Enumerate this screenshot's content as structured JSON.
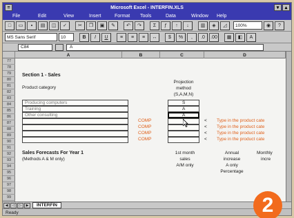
{
  "window": {
    "title": "Microsoft Excel - INTERFIN.XLS"
  },
  "menu": [
    "File",
    "Edit",
    "View",
    "Insert",
    "Format",
    "Tools",
    "Data",
    "Window",
    "Help"
  ],
  "toolbar": {
    "zoom": "100%"
  },
  "format_toolbar": {
    "font": "MS Sans Serif",
    "size": "10"
  },
  "formula_bar": {
    "name_box": "C84",
    "value": "A"
  },
  "columns": [
    "A",
    "B",
    "C",
    "D"
  ],
  "rows": [
    "77",
    "78",
    "79",
    "80",
    "81",
    "82",
    "83",
    "84",
    "85",
    "86",
    "87",
    "88",
    "89",
    "90",
    "91",
    "92",
    "93",
    "94",
    "95",
    "96",
    "97",
    "98",
    "99"
  ],
  "sheet": {
    "section_title": "Section 1 - Sales",
    "product_category": "Product category",
    "projection_header": [
      "Projection",
      "method",
      "(S,A,M,N)"
    ],
    "categories": [
      {
        "name": "Producing computers",
        "method": "S"
      },
      {
        "name": "Training",
        "method": "A"
      },
      {
        "name": "Other consulting",
        "method": "A"
      }
    ],
    "comp_label": "COMP",
    "hint": "Type in the product cate",
    "forecast_title": "Sales Forecasts For Year 1",
    "forecast_subtitle": "(Methods A & M only)",
    "forecast_cols": [
      [
        "1st month",
        "sales",
        "A/M only"
      ],
      [
        "Annual",
        "increase",
        "A only",
        "Percentage"
      ],
      [
        "Monthly",
        "incre"
      ]
    ]
  },
  "sheet_tab": "INTERFIN",
  "status": "Ready",
  "badge": "2"
}
